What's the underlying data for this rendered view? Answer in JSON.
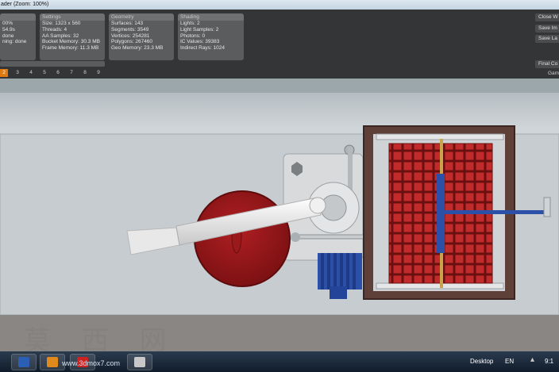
{
  "window": {
    "title": "ader (Zoom: 100%)"
  },
  "panels": {
    "status": {
      "lines": [
        "00%",
        "54.9s",
        "done",
        "ning: done"
      ]
    },
    "settings": {
      "title": "Settings",
      "lines": [
        "Size: 1323 x 560",
        "Threads: 4",
        "AA Samples: 32",
        "Bucket Memory: 30.3 MB",
        "Frame Memory: 11.3 MB"
      ]
    },
    "geometry": {
      "title": "Geometry",
      "lines": [
        "Surfaces: 143",
        "Segments: 3549",
        "Vertices: 254281",
        "Polygons: 267460",
        "Geo Memory: 23.3 MB"
      ]
    },
    "shading": {
      "title": "Shading",
      "lines": [
        "Lights: 2",
        "Light Samples: 2",
        "Photons: 0",
        "IC Values: 39383",
        "Indirect Rays: 1024"
      ]
    }
  },
  "buffers": {
    "items": [
      "2",
      "3",
      "4",
      "5",
      "6",
      "7",
      "8",
      "9"
    ],
    "active": "2"
  },
  "right_buttons": {
    "close": "Close W",
    "save_image": "Save Im",
    "save_layers": "Save La",
    "final": "Final Co",
    "gamma": "Gam"
  },
  "watermark": {
    "text": "莫 西 网"
  },
  "taskbar": {
    "apps": [
      {
        "icon": "word-icon",
        "color": "#2a5fb5",
        "letter": "W"
      },
      {
        "icon": "media-player-icon",
        "color": "#e08a1e",
        "letter": ""
      },
      {
        "icon": "solidworks-icon",
        "color": "#cc2222",
        "letter": "SW"
      },
      {
        "icon": "3d-app-icon",
        "color": "#c8c8c8",
        "letter": ""
      }
    ],
    "site_text": "www.3dmox7.com",
    "desktop_label": "Desktop",
    "language": "EN",
    "time": "9:1"
  },
  "colors": {
    "accent": "#e07a10",
    "panel": "#5a5c5e",
    "red_grid": "#b8282a",
    "blue_part": "#2c4fa8"
  }
}
